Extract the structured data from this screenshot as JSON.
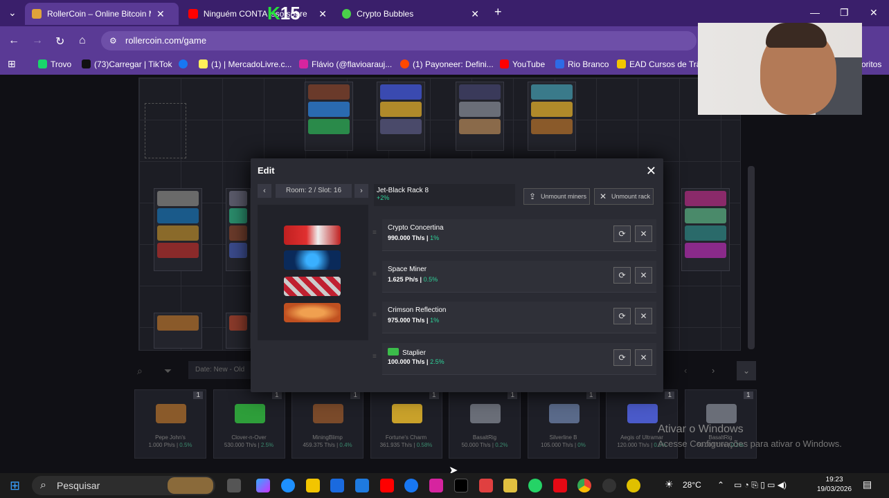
{
  "browser": {
    "tabs": [
      {
        "title": "RollerCoin – Online Bitcoin Mining",
        "active": true,
        "icon": "rollercoin-icon"
      },
      {
        "title": "Ninguém CONTA isso sobre",
        "active": false,
        "icon": "youtube-icon"
      },
      {
        "title": "Crypto Bubbles",
        "active": false,
        "icon": "bubbles-icon"
      }
    ],
    "new_tab": "+",
    "url": "rollercoin.com/game",
    "bookmarks": [
      {
        "label": "Trovo",
        "color": "#19d66b"
      },
      {
        "label": "(73)Carregar | TikTok",
        "color": "#111111"
      },
      {
        "label": "",
        "color": "#1877f2"
      },
      {
        "label": "(1) | MercadoLivre.c...",
        "color": "#fff159"
      },
      {
        "label": "Flávio (@flavioarauj...",
        "color": "#d6249f"
      },
      {
        "label": "(1) Payoneer: Defini...",
        "color": "#ff4800"
      },
      {
        "label": "YouTube",
        "color": "#ff0000"
      },
      {
        "label": "Rio Branco",
        "color": "#2e6be6"
      },
      {
        "label": "EAD Cursos de Trân",
        "color": "#f2c500"
      },
      {
        "label": "oritos",
        "color": "#5a3a95"
      }
    ],
    "overlay_badge": "15"
  },
  "modal": {
    "title": "Edit",
    "room_label": "Room: 2 / Slot: 16",
    "rack_name": "Jet-Black Rack 8",
    "rack_bonus": "+2%",
    "unmount_miners": "Unmount miners",
    "unmount_rack": "Unmount rack",
    "miners": [
      {
        "name": "Crypto Concertina",
        "power": "990.000 Th/s",
        "bonus": "1%",
        "badge": false
      },
      {
        "name": "Space Miner",
        "power": "1.625 Ph/s",
        "bonus": "0.5%",
        "badge": false
      },
      {
        "name": "Crimson Reflection",
        "power": "975.000 Th/s",
        "bonus": "1%",
        "badge": false
      },
      {
        "name": "Staplier",
        "power": "100.000 Th/s",
        "bonus": "2.5%",
        "badge": true
      }
    ]
  },
  "inventory": {
    "sort_label": "Date: New - Old",
    "cards": [
      {
        "name": "Pepe John's",
        "power": "1.000 Ph/s",
        "bonus": "0.5%",
        "count": "1",
        "color": "#8a5a2a"
      },
      {
        "name": "Clover-n-Over",
        "power": "530.000 Th/s",
        "bonus": "2.5%",
        "count": "1",
        "color": "#2e9e3a"
      },
      {
        "name": "MiningBlimp",
        "power": "459.375 Th/s",
        "bonus": "0.4%",
        "count": "1",
        "color": "#7a4a2a"
      },
      {
        "name": "Fortune's Charm",
        "power": "361.935 Th/s",
        "bonus": "0.58%",
        "count": "1",
        "color": "#c9a12a"
      },
      {
        "name": "BasaltRig",
        "power": "50.000 Th/s",
        "bonus": "0.2%",
        "count": "1",
        "color": "#6a6e78"
      },
      {
        "name": "Silverline B",
        "power": "105.000 Th/s",
        "bonus": "0%",
        "count": "1",
        "color": "#5a6a8a"
      },
      {
        "name": "Aegis of Ultramar",
        "power": "120.000 Th/s",
        "bonus": "0.5%",
        "count": "1",
        "color": "#4a5ac9"
      },
      {
        "name": "BasaltRig",
        "power": "50.000 Th/s",
        "bonus": "0.2%",
        "count": "1",
        "color": "#6a6e78"
      }
    ]
  },
  "watermark": {
    "line1": "Ativar o Windows",
    "line2": "Acesse Configurações para ativar o Windows."
  },
  "taskbar": {
    "search_placeholder": "Pesquisar",
    "weather": "28°C",
    "time": "19:23",
    "date": "19/03/2026"
  }
}
